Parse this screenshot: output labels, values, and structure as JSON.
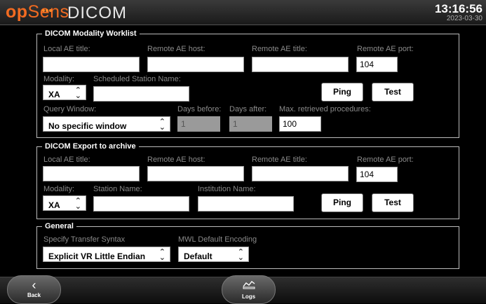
{
  "header": {
    "logo_op": "op",
    "logo_sens": "Sens",
    "title": "DICOM",
    "time": "13:16:56",
    "date": "2023-03-30"
  },
  "worklist": {
    "legend": "DICOM Modality Worklist",
    "local_ae_title_label": "Local AE title:",
    "local_ae_title_value": "",
    "remote_ae_host_label": "Remote AE host:",
    "remote_ae_host_value": "",
    "remote_ae_title_label": "Remote AE title:",
    "remote_ae_title_value": "",
    "remote_ae_port_label": "Remote AE port:",
    "remote_ae_port_value": "104",
    "modality_label": "Modality:",
    "modality_value": "XA",
    "scheduled_station_label": "Scheduled Station Name:",
    "scheduled_station_value": "",
    "ping_label": "Ping",
    "test_label": "Test",
    "query_window_label": "Query Window:",
    "query_window_value": "No specific window",
    "days_before_label": "Days before:",
    "days_before_value": "1",
    "days_after_label": "Days after:",
    "days_after_value": "1",
    "max_retrieved_label": "Max. retrieved procedures:",
    "max_retrieved_value": "100"
  },
  "export": {
    "legend": "DICOM Export to archive",
    "local_ae_title_label": "Local AE title:",
    "local_ae_title_value": "",
    "remote_ae_host_label": "Remote AE host:",
    "remote_ae_host_value": "",
    "remote_ae_title_label": "Remote AE title:",
    "remote_ae_title_value": "",
    "remote_ae_port_label": "Remote AE port:",
    "remote_ae_port_value": "104",
    "modality_label": "Modality:",
    "modality_value": "XA",
    "station_name_label": "Station Name:",
    "station_name_value": "",
    "institution_name_label": "Institution Name:",
    "institution_name_value": "",
    "ping_label": "Ping",
    "test_label": "Test"
  },
  "general": {
    "legend": "General",
    "transfer_syntax_label": "Specify Transfer Syntax",
    "transfer_syntax_value": "Explicit VR Little Endian",
    "mwl_encoding_label": "MWL Default Encoding",
    "mwl_encoding_value": "Default"
  },
  "footer": {
    "back_label": "Back",
    "back_icon": "chevron-left-icon",
    "logs_label": "Logs",
    "logs_icon": "logs-icon"
  },
  "colors": {
    "brand_orange": "#f26b21",
    "background": "#000000"
  }
}
